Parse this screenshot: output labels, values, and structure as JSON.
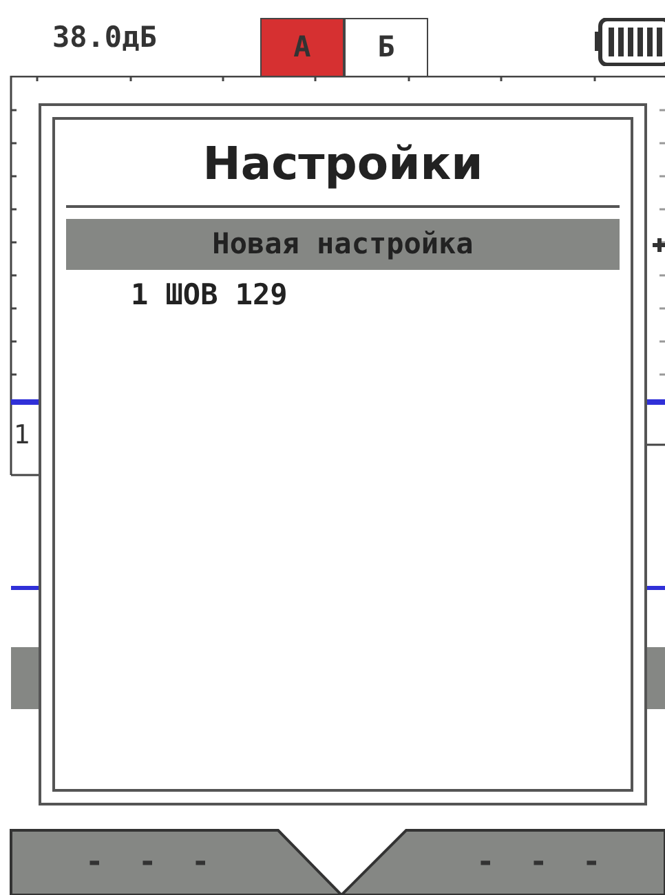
{
  "gain": "38.0дБ",
  "channel_tabs": [
    {
      "label": "А",
      "selected": true
    },
    {
      "label": "Б",
      "selected": false
    }
  ],
  "scale_label": "1",
  "softkeys": [
    {
      "label": "- - -"
    },
    {
      "label": "- - -"
    }
  ],
  "dialog": {
    "title": "Настройки",
    "items": [
      {
        "label": "Новая настройка",
        "selected": true
      },
      {
        "label": "1 ШОВ 129",
        "selected": false
      }
    ]
  }
}
